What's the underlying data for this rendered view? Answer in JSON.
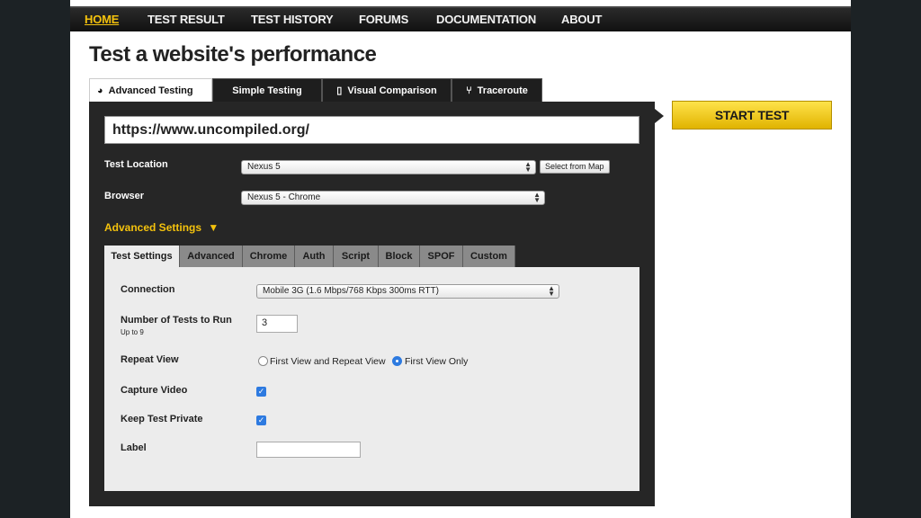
{
  "nav": {
    "home": "HOME",
    "test_result": "TEST RESULT",
    "test_history": "TEST HISTORY",
    "forums": "FORUMS",
    "documentation": "DOCUMENTATION",
    "about": "ABOUT"
  },
  "page_title": "Test a website's performance",
  "tabs": {
    "advanced": "Advanced Testing",
    "simple": "Simple Testing",
    "visual": "Visual Comparison",
    "traceroute": "Traceroute"
  },
  "url": {
    "value": "https://www.uncompiled.org/"
  },
  "test_location": {
    "label": "Test Location",
    "value": "Nexus 5",
    "map_button": "Select from Map"
  },
  "browser": {
    "label": "Browser",
    "value": "Nexus 5 - Chrome"
  },
  "advanced_settings": {
    "label": "Advanced Settings",
    "caret": "▼"
  },
  "subtabs": [
    "Test Settings",
    "Advanced",
    "Chrome",
    "Auth",
    "Script",
    "Block",
    "SPOF",
    "Custom"
  ],
  "settings": {
    "connection": {
      "label": "Connection",
      "value": "Mobile 3G (1.6 Mbps/768 Kbps 300ms RTT)"
    },
    "num_tests": {
      "label": "Number of Tests to Run",
      "sublabel": "Up to 9",
      "value": "3"
    },
    "repeat_view": {
      "label": "Repeat View",
      "option1": "First View and Repeat View",
      "option2": "First View Only",
      "selected": "First View Only"
    },
    "capture_video": {
      "label": "Capture Video",
      "checked": true
    },
    "keep_private": {
      "label": "Keep Test Private",
      "checked": true
    },
    "test_label": {
      "label": "Label",
      "value": ""
    }
  },
  "start_button": "START TEST",
  "colors": {
    "accent": "#f4c20d",
    "panel": "#262626",
    "checkbox": "#2d7ae0"
  }
}
